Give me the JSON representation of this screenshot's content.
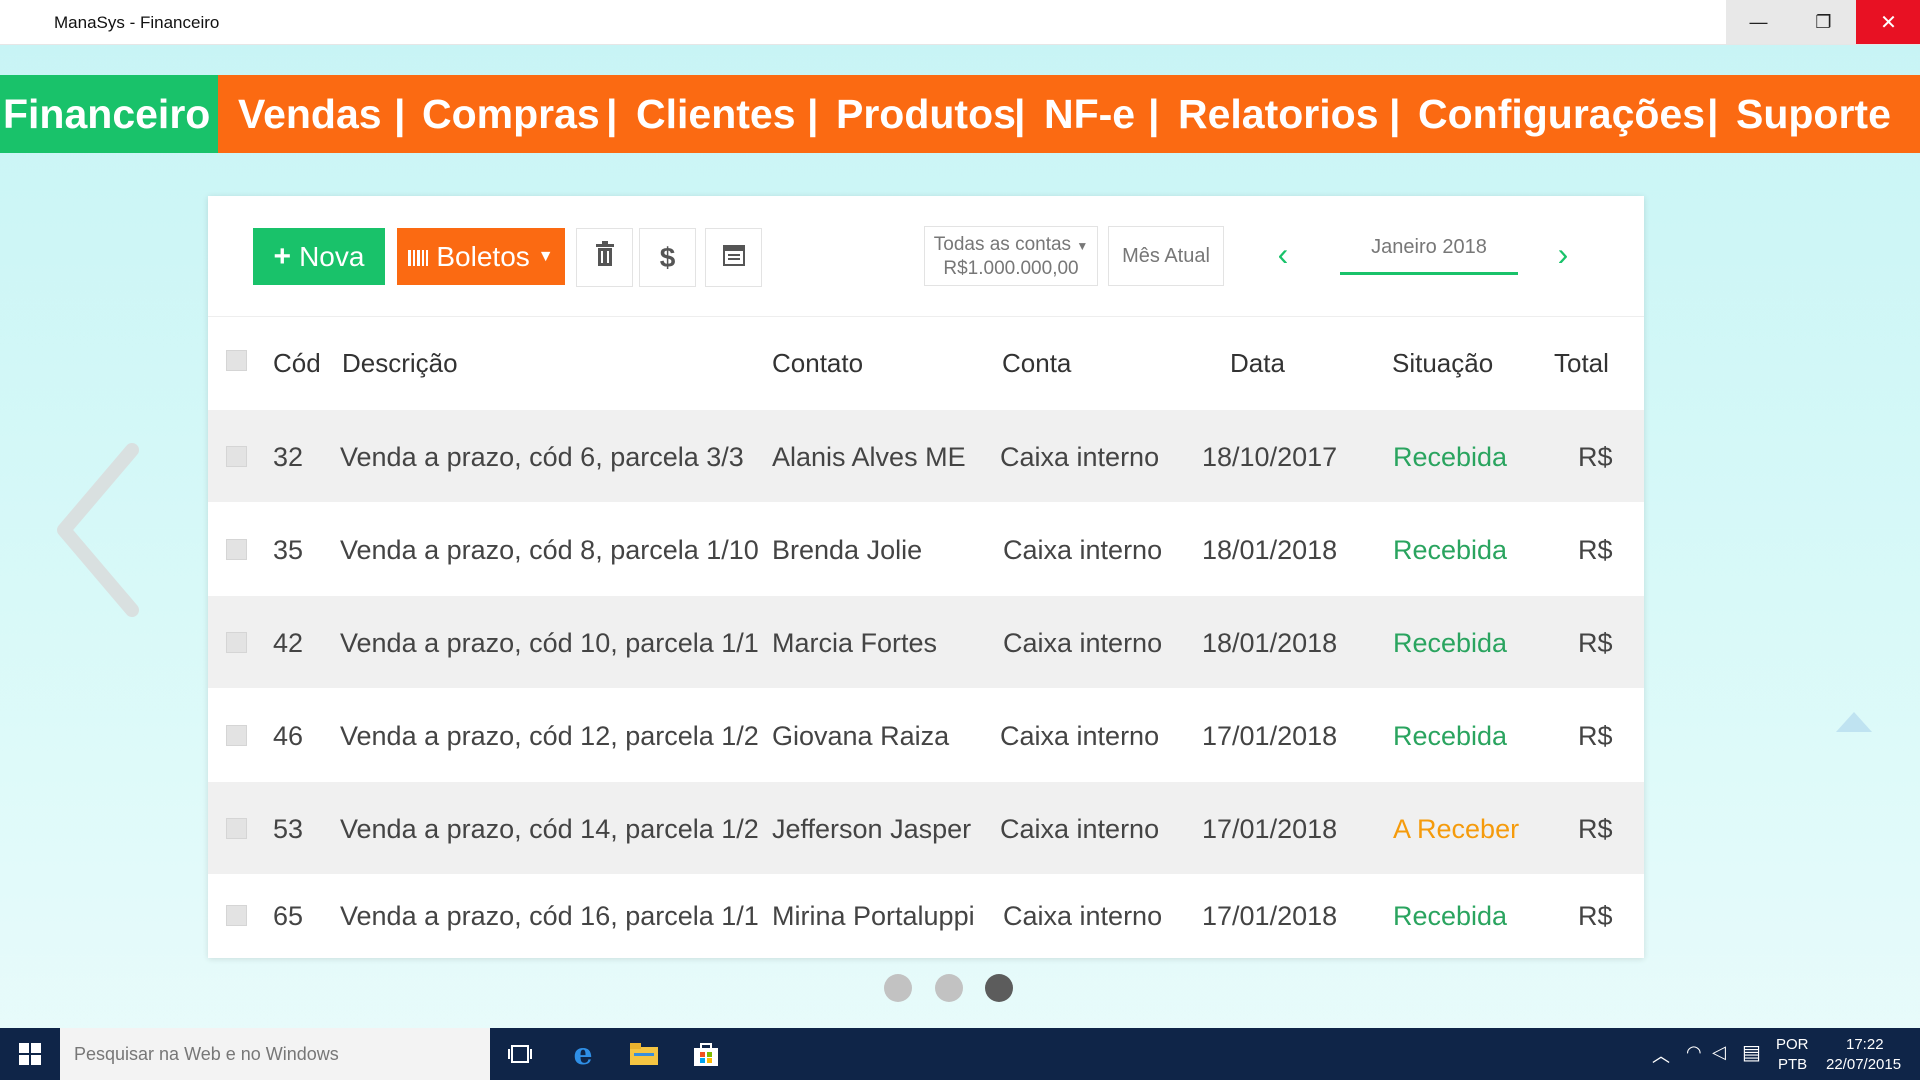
{
  "window": {
    "title": "ManaSys - Financeiro",
    "min_label": "—",
    "max_label": "❐",
    "close_label": "✕"
  },
  "nav": {
    "active": "Financeiro",
    "items": [
      "Vendas",
      "Compras",
      "Clientes",
      "Produtos",
      "NF-e",
      "Relatorios",
      "Configurações",
      "Suporte"
    ],
    "separator": "|"
  },
  "toolbar": {
    "nova_label": "Nova",
    "boletos_label": "Boletos",
    "accounts_line1": "Todas as contas",
    "accounts_line2": "R$1.000.000,00",
    "mes_atual": "Mês Atual",
    "month": "Janeiro 2018"
  },
  "table": {
    "headers": {
      "cod": "Cód",
      "descricao": "Descrição",
      "contato": "Contato",
      "conta": "Conta",
      "data": "Data",
      "situacao": "Situação",
      "total": "Total"
    },
    "rows": [
      {
        "cod": "32",
        "descricao": "Venda a prazo, cód 6, parcela 3/3",
        "contato": "Alanis Alves ME",
        "conta": "Caixa interno",
        "data": "18/10/2017",
        "situacao": "Recebida",
        "total": "R$"
      },
      {
        "cod": "35",
        "descricao": "Venda a prazo, cód 8, parcela 1/10",
        "contato": "Brenda Jolie",
        "conta": "Caixa interno",
        "data": "18/01/2018",
        "situacao": "Recebida",
        "total": "R$"
      },
      {
        "cod": "42",
        "descricao": "Venda a prazo, cód 10, parcela 1/1",
        "contato": "Marcia Fortes",
        "conta": "Caixa interno",
        "data": "18/01/2018",
        "situacao": "Recebida",
        "total": "R$"
      },
      {
        "cod": "46",
        "descricao": "Venda a prazo, cód 12, parcela 1/2",
        "contato": "Giovana Raiza",
        "conta": "Caixa interno",
        "data": "17/01/2018",
        "situacao": "Recebida",
        "total": "R$"
      },
      {
        "cod": "53",
        "descricao": "Venda a prazo, cód 14, parcela 1/2",
        "contato": "Jefferson Jasper",
        "conta": "Caixa interno",
        "data": "17/01/2018",
        "situacao": "A Receber",
        "total": "R$"
      },
      {
        "cod": "65",
        "descricao": "Venda a prazo, cód 16, parcela 1/1",
        "contato": "Mirina Portaluppi",
        "conta": "Caixa interno",
        "data": "17/01/2018",
        "situacao": "Recebida",
        "total": "R$"
      }
    ]
  },
  "carousel": {
    "pages": 3,
    "active_page": 3
  },
  "taskbar": {
    "search_placeholder": "Pesquisar na Web e no Windows",
    "lang1": "POR",
    "lang2": "PTB",
    "time": "17:22",
    "date": "22/07/2015"
  },
  "colors": {
    "orange": "#fb6a12",
    "green": "#19c26a",
    "status_ok": "#2aa45f",
    "status_pending": "#f59b0c"
  },
  "icons": [
    "windows-start-icon",
    "task-view-icon",
    "edge-icon",
    "file-explorer-icon",
    "store-icon",
    "trash-icon",
    "dollar-icon",
    "calendar-icon",
    "barcode-icon",
    "plus-icon"
  ]
}
